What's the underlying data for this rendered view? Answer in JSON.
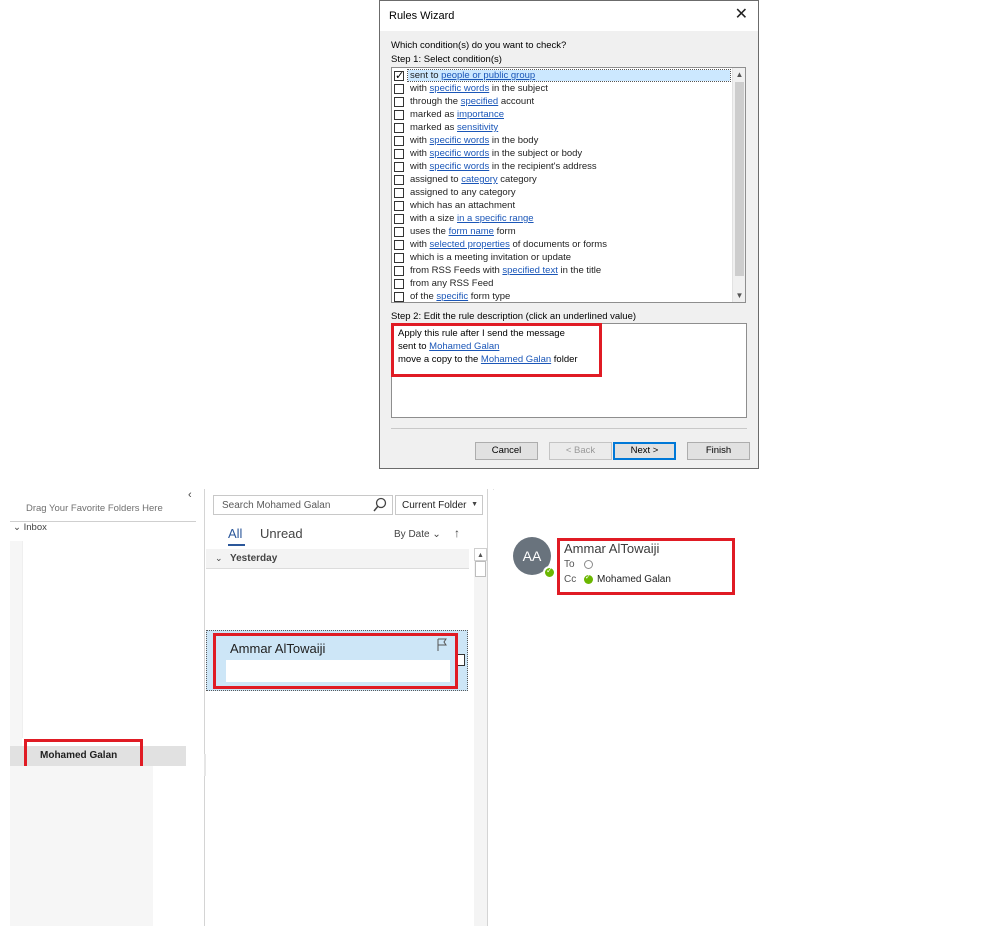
{
  "wizard": {
    "title": "Rules Wizard",
    "close_glyph": "✕",
    "question": "Which condition(s) do you want to check?",
    "step1": "Step 1: Select condition(s)",
    "step2": "Step 2: Edit the rule description (click an underlined value)",
    "conditions": [
      {
        "checked": true,
        "parts": [
          {
            "t": "sent to "
          },
          {
            "t": "people or public group",
            "link": true
          }
        ]
      },
      {
        "checked": false,
        "parts": [
          {
            "t": "with "
          },
          {
            "t": "specific words",
            "link": true
          },
          {
            "t": " in the subject"
          }
        ]
      },
      {
        "checked": false,
        "parts": [
          {
            "t": "through the "
          },
          {
            "t": "specified",
            "link": true
          },
          {
            "t": " account"
          }
        ]
      },
      {
        "checked": false,
        "parts": [
          {
            "t": "marked as "
          },
          {
            "t": "importance",
            "link": true
          }
        ]
      },
      {
        "checked": false,
        "parts": [
          {
            "t": "marked as "
          },
          {
            "t": "sensitivity",
            "link": true
          }
        ]
      },
      {
        "checked": false,
        "parts": [
          {
            "t": "with "
          },
          {
            "t": "specific words",
            "link": true
          },
          {
            "t": " in the body"
          }
        ]
      },
      {
        "checked": false,
        "parts": [
          {
            "t": "with "
          },
          {
            "t": "specific words",
            "link": true
          },
          {
            "t": " in the subject or body"
          }
        ]
      },
      {
        "checked": false,
        "parts": [
          {
            "t": "with "
          },
          {
            "t": "specific words",
            "link": true
          },
          {
            "t": " in the recipient's address"
          }
        ]
      },
      {
        "checked": false,
        "parts": [
          {
            "t": "assigned to "
          },
          {
            "t": "category",
            "link": true
          },
          {
            "t": " category"
          }
        ]
      },
      {
        "checked": false,
        "parts": [
          {
            "t": "assigned to any category"
          }
        ]
      },
      {
        "checked": false,
        "parts": [
          {
            "t": "which has an attachment"
          }
        ]
      },
      {
        "checked": false,
        "parts": [
          {
            "t": "with a size "
          },
          {
            "t": "in a specific range",
            "link": true
          }
        ]
      },
      {
        "checked": false,
        "parts": [
          {
            "t": "uses the "
          },
          {
            "t": "form name",
            "link": true
          },
          {
            "t": " form"
          }
        ]
      },
      {
        "checked": false,
        "parts": [
          {
            "t": "with "
          },
          {
            "t": "selected properties",
            "link": true
          },
          {
            "t": " of documents or forms"
          }
        ]
      },
      {
        "checked": false,
        "parts": [
          {
            "t": "which is a meeting invitation or update"
          }
        ]
      },
      {
        "checked": false,
        "parts": [
          {
            "t": "from RSS Feeds with "
          },
          {
            "t": "specified text",
            "link": true
          },
          {
            "t": " in the title"
          }
        ]
      },
      {
        "checked": false,
        "parts": [
          {
            "t": "from any RSS Feed"
          }
        ]
      },
      {
        "checked": false,
        "parts": [
          {
            "t": "of the "
          },
          {
            "t": "specific",
            "link": true
          },
          {
            "t": " form type"
          }
        ]
      }
    ],
    "description": {
      "line1": "Apply this rule after I send the message",
      "line2_prefix": "sent to ",
      "line2_link": "Mohamed Galan",
      "line3_prefix": "move a copy to the ",
      "line3_link": "Mohamed Galan",
      "line3_suffix": " folder"
    },
    "buttons": {
      "cancel": "Cancel",
      "back": "< Back",
      "next": "Next >",
      "finish": "Finish"
    },
    "scroll_up": "▲",
    "scroll_down": "▼"
  },
  "folders": {
    "favorites_hint": "Drag Your Favorite Folders Here",
    "collapse_glyph": "‹",
    "inbox_label": "Inbox",
    "selected_folder": "Mohamed Galan"
  },
  "message_list": {
    "search_placeholder": "Search Mohamed Galan",
    "scope": "Current Folder",
    "tabs": {
      "all": "All",
      "unread": "Unread"
    },
    "sort_label": "By Date",
    "sort_chevron": "⌄",
    "sort_arrow": "↑",
    "group_label": "Yesterday",
    "group_chevron": "⌄",
    "item": {
      "sender": "Ammar AlTowaiji"
    }
  },
  "reading": {
    "avatar_initials": "AA",
    "sender": "Ammar AlTowaiji",
    "to_label": "To",
    "cc_label": "Cc",
    "cc_name": "Mohamed Galan"
  },
  "colors": {
    "highlight": "#e01b24",
    "link": "#1a56b8",
    "selection": "#cde6f7",
    "presence": "#6bb700"
  }
}
